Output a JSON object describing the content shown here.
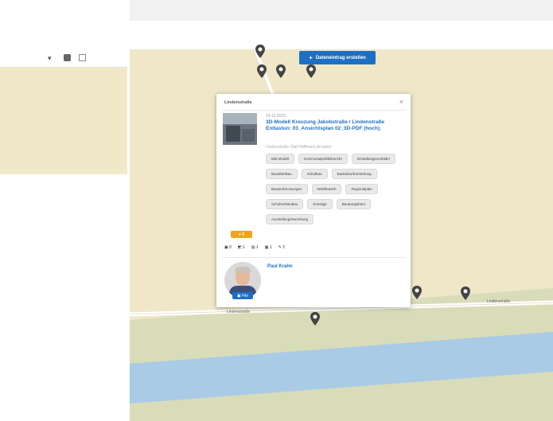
{
  "popup": {
    "title": "Lindenstraße",
    "close": "×",
    "date": "19.12.2019",
    "item_title": "3D-Modell Kreuzung Jakobstraße / Lindenstraße Entlastun: 03_Ansichtsplan 02_3D-PDF (hoch).",
    "subtitle": "Lindenstraße Olaf Hoffmann Arcamer",
    "tags": [
      "Bild Modell",
      "Kommunalpolitik/bericht",
      "Gestaltungsvorbilder",
      "Bauakte/Bau",
      "Schulbau",
      "Baukultur/Entstehung",
      "Bauwerk/Lösungen",
      "Wettbewerb",
      "Regionalplan",
      "Schulen/Neubau",
      "Sonstige",
      "Beratungsbüro",
      "Ausstellung/Sammlung"
    ],
    "version_badge": "v 3",
    "stats": [
      "▣ 0",
      "◩ 1",
      "▤ 1",
      "▦ 1",
      "✎ 2"
    ],
    "author": "Paul Krahn",
    "author_badge": "▣ File"
  },
  "map": {
    "add_button_label": "Dateneintrag erstellen",
    "street_labels": [
      "Lindenstraße",
      "Lindenstraße"
    ]
  },
  "colors": {
    "map_land": "#efe7c8",
    "map_green": "#d9dcb8",
    "map_water": "#aacbe6",
    "road": "#ffffff",
    "accent": "#1d6fc4",
    "badge": "#f2a21b"
  }
}
